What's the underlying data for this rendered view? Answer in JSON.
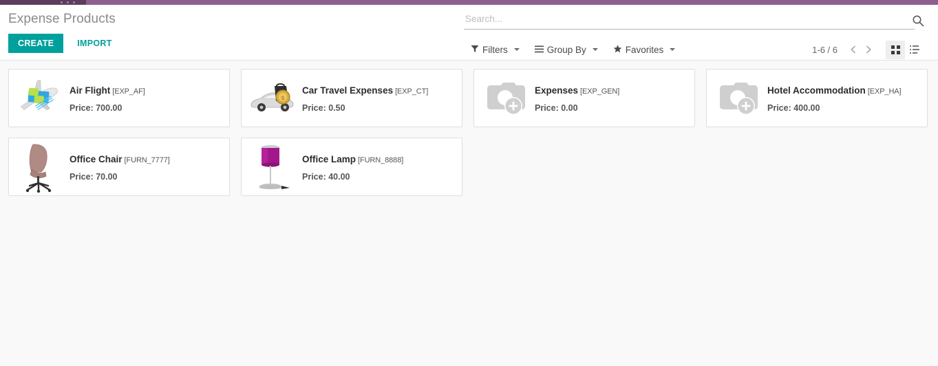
{
  "window": {
    "accent_color": "#8e5f8e",
    "accent_dark": "#5d3c5d"
  },
  "control_panel": {
    "breadcrumb": "Expense Products",
    "create_label": "CREATE",
    "import_label": "IMPORT",
    "primary_color": "#00a09d"
  },
  "search": {
    "placeholder": "Search...",
    "value": "",
    "icon": "search-icon"
  },
  "filters": [
    {
      "label": "Filters",
      "icon": "filter-funnel-icon"
    },
    {
      "label": "Group By",
      "icon": "group-by-lines-icon"
    },
    {
      "label": "Favorites",
      "icon": "star-icon"
    }
  ],
  "pager": {
    "value": "1-6 / 6",
    "previous_icon": "chevron-left-icon",
    "next_icon": "chevron-right-icon"
  },
  "view_switcher": {
    "kanban": {
      "name": "kanban-view",
      "active": true
    },
    "list": {
      "name": "list-view",
      "active": false
    }
  },
  "records": [
    {
      "name": "Air Flight",
      "reference": "[EXP_AF]",
      "price_label": "Price: 700.00",
      "image": "airplane-photo"
    },
    {
      "name": "Car Travel Expenses",
      "reference": "[EXP_CT]",
      "price_label": "Price: 0.50",
      "image": "car-photo"
    },
    {
      "name": "Expenses",
      "reference": "[EXP_GEN]",
      "price_label": "Price: 0.00",
      "image": "camera-placeholder-icon"
    },
    {
      "name": "Hotel Accommodation",
      "reference": "[EXP_HA]",
      "price_label": "Price: 400.00",
      "image": "camera-placeholder-icon"
    },
    {
      "name": "Office Chair",
      "reference": "[FURN_7777]",
      "price_label": "Price: 70.00",
      "image": "office-chair-photo"
    },
    {
      "name": "Office Lamp",
      "reference": "[FURN_8888]",
      "price_label": "Price: 40.00",
      "image": "office-lamp-photo"
    }
  ]
}
